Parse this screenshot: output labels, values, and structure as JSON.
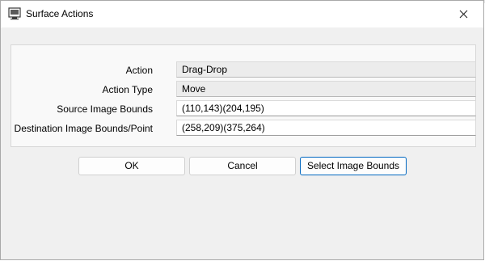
{
  "window": {
    "title": "Surface Actions",
    "icon": "app-window-icon",
    "close_icon": "close-icon"
  },
  "fields": [
    {
      "label": "Action",
      "value": "Drag-Drop",
      "readonly": true
    },
    {
      "label": "Action Type",
      "value": "Move",
      "readonly": true
    },
    {
      "label": "Source Image Bounds",
      "value": "(110,143)(204,195)",
      "readonly": false
    },
    {
      "label": "Destination Image Bounds/Point",
      "value": "(258,209)(375,264)",
      "readonly": false
    }
  ],
  "buttons": {
    "ok": "OK",
    "cancel": "Cancel",
    "select_bounds": "Select Image Bounds"
  },
  "colors": {
    "accent": "#0067c0",
    "dialog_bg": "#f0f0f0",
    "readonly_field": "#ececec"
  }
}
